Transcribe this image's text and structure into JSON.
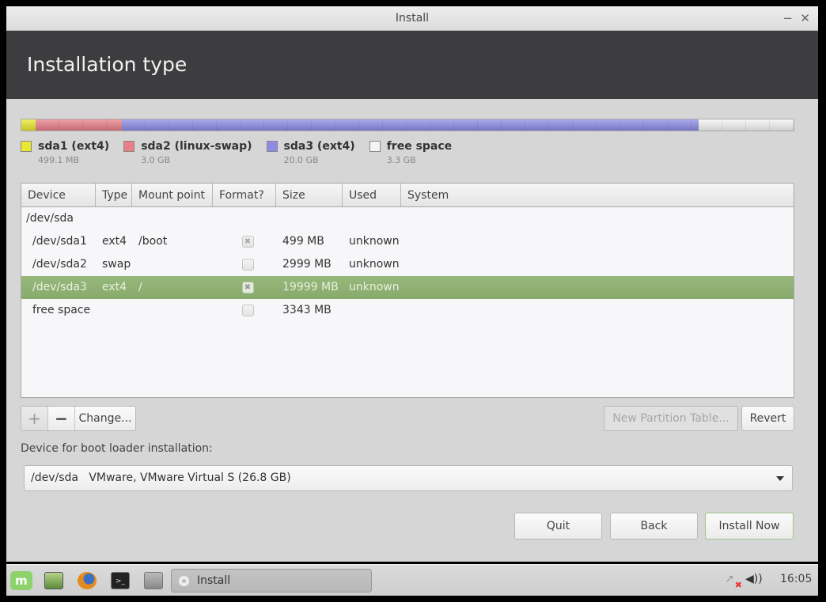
{
  "window": {
    "title": "Install",
    "minimize_label": "−",
    "close_label": "✕"
  },
  "header": {
    "title": "Installation type"
  },
  "disk_bar": {
    "segments": [
      {
        "name": "sda1",
        "fraction": 0.0186,
        "color": "#e8e830"
      },
      {
        "name": "sda2",
        "fraction": 0.1119,
        "color": "#e87f88"
      },
      {
        "name": "sda3",
        "fraction": 0.7463,
        "color": "#8c8ce6"
      },
      {
        "name": "free",
        "fraction": 0.1232,
        "color": "#f4f4f4"
      }
    ]
  },
  "legend": [
    {
      "label": "sda1 (ext4)",
      "size": "499.1 MB",
      "color": "#e8e830"
    },
    {
      "label": "sda2 (linux-swap)",
      "size": "3.0 GB",
      "color": "#e87f88"
    },
    {
      "label": "sda3 (ext4)",
      "size": "20.0 GB",
      "color": "#8c8ce6"
    },
    {
      "label": "free space",
      "size": "3.3 GB",
      "color": "#f4f4f4"
    }
  ],
  "table": {
    "columns": [
      "Device",
      "Type",
      "Mount point",
      "Format?",
      "Size",
      "Used",
      "System"
    ],
    "disk_row": "/dev/sda",
    "rows": [
      {
        "device": "/dev/sda1",
        "type": "ext4",
        "mount": "/boot",
        "format": true,
        "size": "499 MB",
        "used": "unknown",
        "system": "",
        "selected": false
      },
      {
        "device": "/dev/sda2",
        "type": "swap",
        "mount": "",
        "format": false,
        "size": "2999 MB",
        "used": "unknown",
        "system": "",
        "selected": false
      },
      {
        "device": "/dev/sda3",
        "type": "ext4",
        "mount": "/",
        "format": true,
        "size": "19999 MB",
        "used": "unknown",
        "system": "",
        "selected": true
      },
      {
        "device": "free space",
        "type": "",
        "mount": "",
        "format": false,
        "size": "3343 MB",
        "used": "",
        "system": "",
        "selected": false
      }
    ]
  },
  "buttons": {
    "add": "+",
    "remove": "−",
    "change": "Change...",
    "new_partition_table": "New Partition Table...",
    "revert": "Revert",
    "quit": "Quit",
    "back": "Back",
    "install_now": "Install Now"
  },
  "bootloader": {
    "label": "Device for boot loader installation:",
    "selected": "/dev/sda   VMware, VMware Virtual S (26.8 GB)"
  },
  "taskbar": {
    "menu_icon": "linux-mint-icon",
    "launchers": [
      "show-desktop-icon",
      "firefox-icon",
      "terminal-icon",
      "system-manager-icon"
    ],
    "terminal_glyph": ">_",
    "mint_glyph": "m",
    "window_label": "Install",
    "network_glyph": "↗",
    "network_error_glyph": "✖",
    "volume_glyph": "◀))",
    "clock": "16:05"
  }
}
